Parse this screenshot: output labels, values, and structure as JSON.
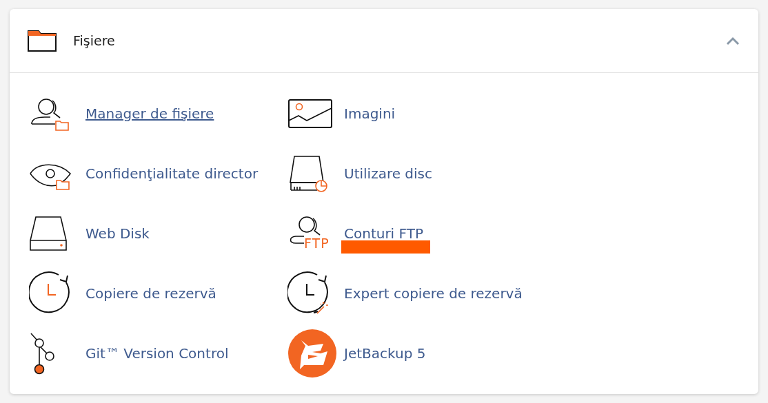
{
  "panel": {
    "title": "Fişiere",
    "expanded": true
  },
  "items": [
    {
      "label": "Manager de fişiere",
      "kind": "user-folder",
      "hovered": true,
      "highlighted": false
    },
    {
      "label": "Imagini",
      "kind": "image",
      "hovered": false,
      "highlighted": false
    },
    {
      "label": "Confidenţialitate director",
      "kind": "eye-folder",
      "hovered": false,
      "highlighted": false
    },
    {
      "label": "Utilizare disc",
      "kind": "disk-chart",
      "hovered": false,
      "highlighted": false
    },
    {
      "label": "Web Disk",
      "kind": "disk",
      "hovered": false,
      "highlighted": false
    },
    {
      "label": "Conturi FTP",
      "kind": "user-ftp",
      "icon_text": "FTP",
      "hovered": false,
      "highlighted": true
    },
    {
      "label": "Copiere de rezervă",
      "kind": "clock",
      "hovered": false,
      "highlighted": false
    },
    {
      "label": "Expert copiere de rezervă",
      "kind": "clock-wand",
      "hovered": false,
      "highlighted": false
    },
    {
      "label": "Git™ Version Control",
      "kind": "git",
      "hovered": false,
      "highlighted": false
    },
    {
      "label": "JetBackup 5",
      "kind": "jetbackup",
      "hovered": false,
      "highlighted": false
    }
  ]
}
